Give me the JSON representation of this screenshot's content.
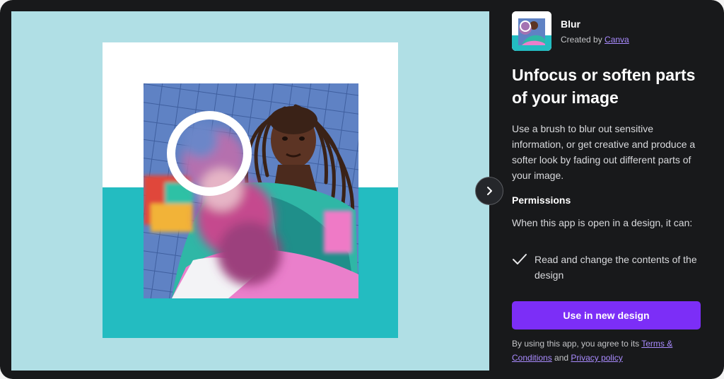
{
  "app": {
    "name": "Blur",
    "creator_prefix": "Created by ",
    "creator_link": "Canva",
    "thumbnail_icon": "blur-app-thumbnail-icon"
  },
  "headline": "Unfocus or soften parts of your image",
  "description": "Use a brush to blur out sensitive information, or get creative and produce a softer look by fading out different parts of your image.",
  "permissions": {
    "title": "Permissions",
    "intro": "When this app is open in a design, it can:",
    "items": [
      {
        "text": "Read and change the contents of the design",
        "icon": "check-icon"
      }
    ]
  },
  "cta_label": "Use in new design",
  "legal": {
    "prefix": "By using this app, you agree to its ",
    "terms_link": "Terms & Conditions",
    "middle": " and ",
    "privacy_link": "Privacy policy"
  },
  "navigation": {
    "next_icon": "chevron-right-icon"
  },
  "colors": {
    "panel_background": "#18191b",
    "preview_background": "#b0dfe5",
    "teal_band": "#23bcc1",
    "accent_purple": "#7c2ef7",
    "link_purple": "#a98bff"
  }
}
